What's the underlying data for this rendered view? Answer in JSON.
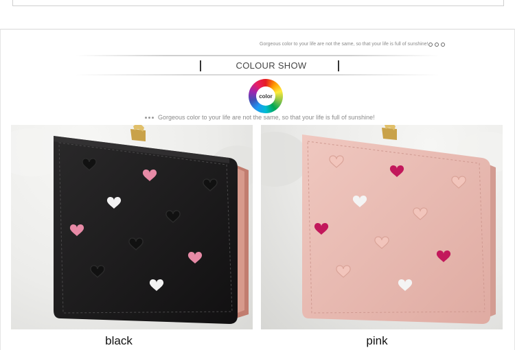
{
  "header": {
    "tagline_small": "Gorgeous color to your life are not the same, so that your life is full of sunshine!",
    "title": "COLOUR SHOW",
    "wheel_label": "color",
    "tagline": "Gorgeous color to your life are not the same, so that your life is full of sunshine!"
  },
  "products": [
    {
      "label": "black",
      "wallet_color": "#1c1b1c",
      "heart_colors": [
        "#e78aa6",
        "#f2f2f2",
        "#141414"
      ]
    },
    {
      "label": "pink",
      "wallet_color": "#e8b8b0",
      "heart_colors": [
        "#c2185b",
        "#f4f4f4",
        "#dba39a"
      ]
    }
  ]
}
